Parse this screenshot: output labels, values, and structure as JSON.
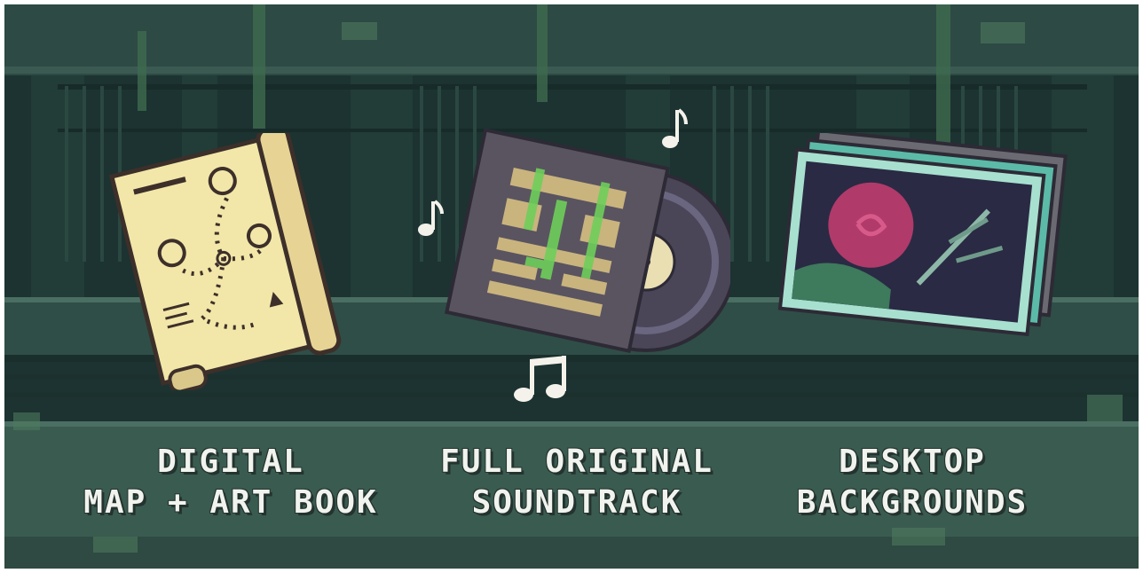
{
  "features": [
    {
      "line1": "DIGITAL",
      "line2": "MAP + ART BOOK",
      "icon": "treasure-map-icon"
    },
    {
      "line1": "FULL ORIGINAL",
      "line2": "SOUNDTRACK",
      "icon": "vinyl-record-icon"
    },
    {
      "line1": "DESKTOP",
      "line2": "BACKGROUNDS",
      "icon": "photo-stack-icon"
    }
  ],
  "colors": {
    "background": "#1f3a36",
    "caption_text": "#f1f3ee",
    "map_paper": "#f2e7a8",
    "album_cover": "#5a5460",
    "photo_frame": "#a8e0cf"
  }
}
